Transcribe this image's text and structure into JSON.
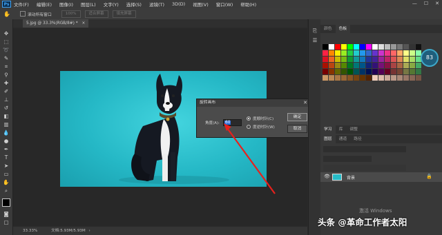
{
  "app": {
    "logo": "Ps"
  },
  "menu": [
    "文件(F)",
    "编辑(E)",
    "图像(I)",
    "图层(L)",
    "文字(Y)",
    "选择(S)",
    "滤镜(T)",
    "3D(D)",
    "视图(V)",
    "窗口(W)",
    "帮助(H)"
  ],
  "window_controls": [
    "minimize-icon",
    "maximize-icon",
    "close-icon"
  ],
  "options_bar": {
    "scroll_all_label": "滚动所有窗口",
    "buttons": [
      "100%",
      "适合屏幕",
      "填充屏幕"
    ]
  },
  "document": {
    "tab_title": "5.jpg @ 33.3%(RGB/8#) *",
    "close_glyph": "×"
  },
  "dialog": {
    "title": "旋转画布",
    "angle_label": "角度(A):",
    "angle_value": "60",
    "option_cw": "度顺时针(C)",
    "option_ccw": "度逆时针(W)",
    "selected_option": "cw",
    "ok": "确定",
    "cancel": "取消"
  },
  "status": {
    "zoom": "33.33%",
    "doc": "文档:5.93M/5.93M",
    "arrow": "›"
  },
  "panels": {
    "top_tabs": [
      "颜色",
      "色板"
    ],
    "top_active": 1,
    "mid_tabs": [
      "学习",
      "库",
      "调整"
    ],
    "mid_active": 0,
    "layer_tabs": [
      "图层",
      "通道",
      "路径"
    ],
    "layer_active": 0,
    "layer_name": "背景"
  },
  "gauge_value": "83",
  "watermark": "激活 Windows",
  "caption": "头条 @革命工作者太阳",
  "colors": {
    "accent": "#2d6cd8",
    "annotation_arrow": "#e8201c",
    "photo_bg": "#25b8c6"
  }
}
